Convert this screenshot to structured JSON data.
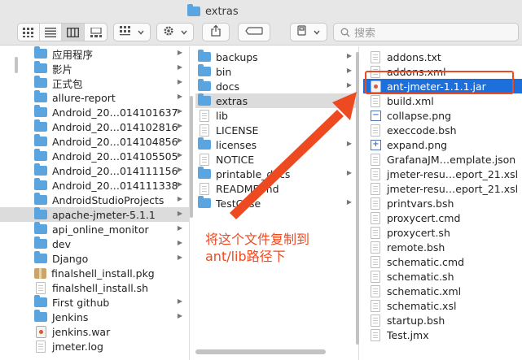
{
  "window": {
    "title": "extras"
  },
  "toolbar": {
    "view_icons": [
      "icon-view-icon",
      "list-view-icon",
      "column-view-icon",
      "gallery-view-icon"
    ],
    "group_icon": "group-icon",
    "action_icon": "gear-icon",
    "share_icon": "share-icon",
    "tag_icon": "tag-icon",
    "path_icon": "path-icon",
    "search_placeholder": "搜索"
  },
  "column1": {
    "items": [
      {
        "label": "应用程序",
        "type": "folder"
      },
      {
        "label": "影片",
        "type": "folder"
      },
      {
        "label": "正式包",
        "type": "folder"
      },
      {
        "label": "allure-report",
        "type": "folder"
      },
      {
        "label": "Android_20…014101637",
        "type": "folder"
      },
      {
        "label": "Android_20…014102816",
        "type": "folder"
      },
      {
        "label": "Android_20…014104856",
        "type": "folder"
      },
      {
        "label": "Android_20…014105505",
        "type": "folder"
      },
      {
        "label": "Android_20…014111156",
        "type": "folder"
      },
      {
        "label": "Android_20…014111338",
        "type": "folder"
      },
      {
        "label": "AndroidStudioProjects",
        "type": "folder"
      },
      {
        "label": "apache-jmeter-5.1.1",
        "type": "folder",
        "selected": true
      },
      {
        "label": "api_online_monitor",
        "type": "folder"
      },
      {
        "label": "dev",
        "type": "folder"
      },
      {
        "label": "Django",
        "type": "folder"
      },
      {
        "label": "finalshell_install.pkg",
        "type": "pkg"
      },
      {
        "label": "finalshell_install.sh",
        "type": "file"
      },
      {
        "label": "First github",
        "type": "folder"
      },
      {
        "label": "Jenkins",
        "type": "folder"
      },
      {
        "label": "jenkins.war",
        "type": "jar"
      },
      {
        "label": "jmeter.log",
        "type": "file"
      }
    ]
  },
  "column2": {
    "items": [
      {
        "label": "backups",
        "type": "folder"
      },
      {
        "label": "bin",
        "type": "folder"
      },
      {
        "label": "docs",
        "type": "folder"
      },
      {
        "label": "extras",
        "type": "folder",
        "selected": true
      },
      {
        "label": "lib",
        "type": "file"
      },
      {
        "label": "LICENSE",
        "type": "file"
      },
      {
        "label": "licenses",
        "type": "folder"
      },
      {
        "label": "NOTICE",
        "type": "file"
      },
      {
        "label": "printable_docs",
        "type": "folder"
      },
      {
        "label": "README.md",
        "type": "file"
      },
      {
        "label": "TestCase",
        "type": "folder"
      }
    ]
  },
  "column3": {
    "items": [
      {
        "label": "addons.txt",
        "type": "file"
      },
      {
        "label": "addons.xml",
        "type": "file"
      },
      {
        "label": "ant-jmeter-1.1.1.jar",
        "type": "jar",
        "selected": true
      },
      {
        "label": "build.xml",
        "type": "file"
      },
      {
        "label": "collapse.png",
        "type": "png",
        "glyph": "−"
      },
      {
        "label": "execcode.bsh",
        "type": "file"
      },
      {
        "label": "expand.png",
        "type": "png",
        "glyph": "+"
      },
      {
        "label": "GrafanaJM…emplate.json",
        "type": "file"
      },
      {
        "label": "jmeter-resu…eport_21.xsl",
        "type": "file"
      },
      {
        "label": "jmeter-resu…eport_21.xsl",
        "type": "file"
      },
      {
        "label": "printvars.bsh",
        "type": "file"
      },
      {
        "label": "proxycert.cmd",
        "type": "file"
      },
      {
        "label": "proxycert.sh",
        "type": "file"
      },
      {
        "label": "remote.bsh",
        "type": "file"
      },
      {
        "label": "schematic.cmd",
        "type": "file"
      },
      {
        "label": "schematic.sh",
        "type": "file"
      },
      {
        "label": "schematic.xml",
        "type": "file"
      },
      {
        "label": "schematic.xsl",
        "type": "file"
      },
      {
        "label": "startup.bsh",
        "type": "file"
      },
      {
        "label": "Test.jmx",
        "type": "file"
      }
    ]
  },
  "annotation": {
    "line1": "将这个文件复制到",
    "line2": "ant/lib路径下",
    "color": "#ee4a22"
  },
  "colors": {
    "selection_blue": "#1d6fdb",
    "selection_gray": "#dcdcdc",
    "folder": "#5aa4e0"
  }
}
